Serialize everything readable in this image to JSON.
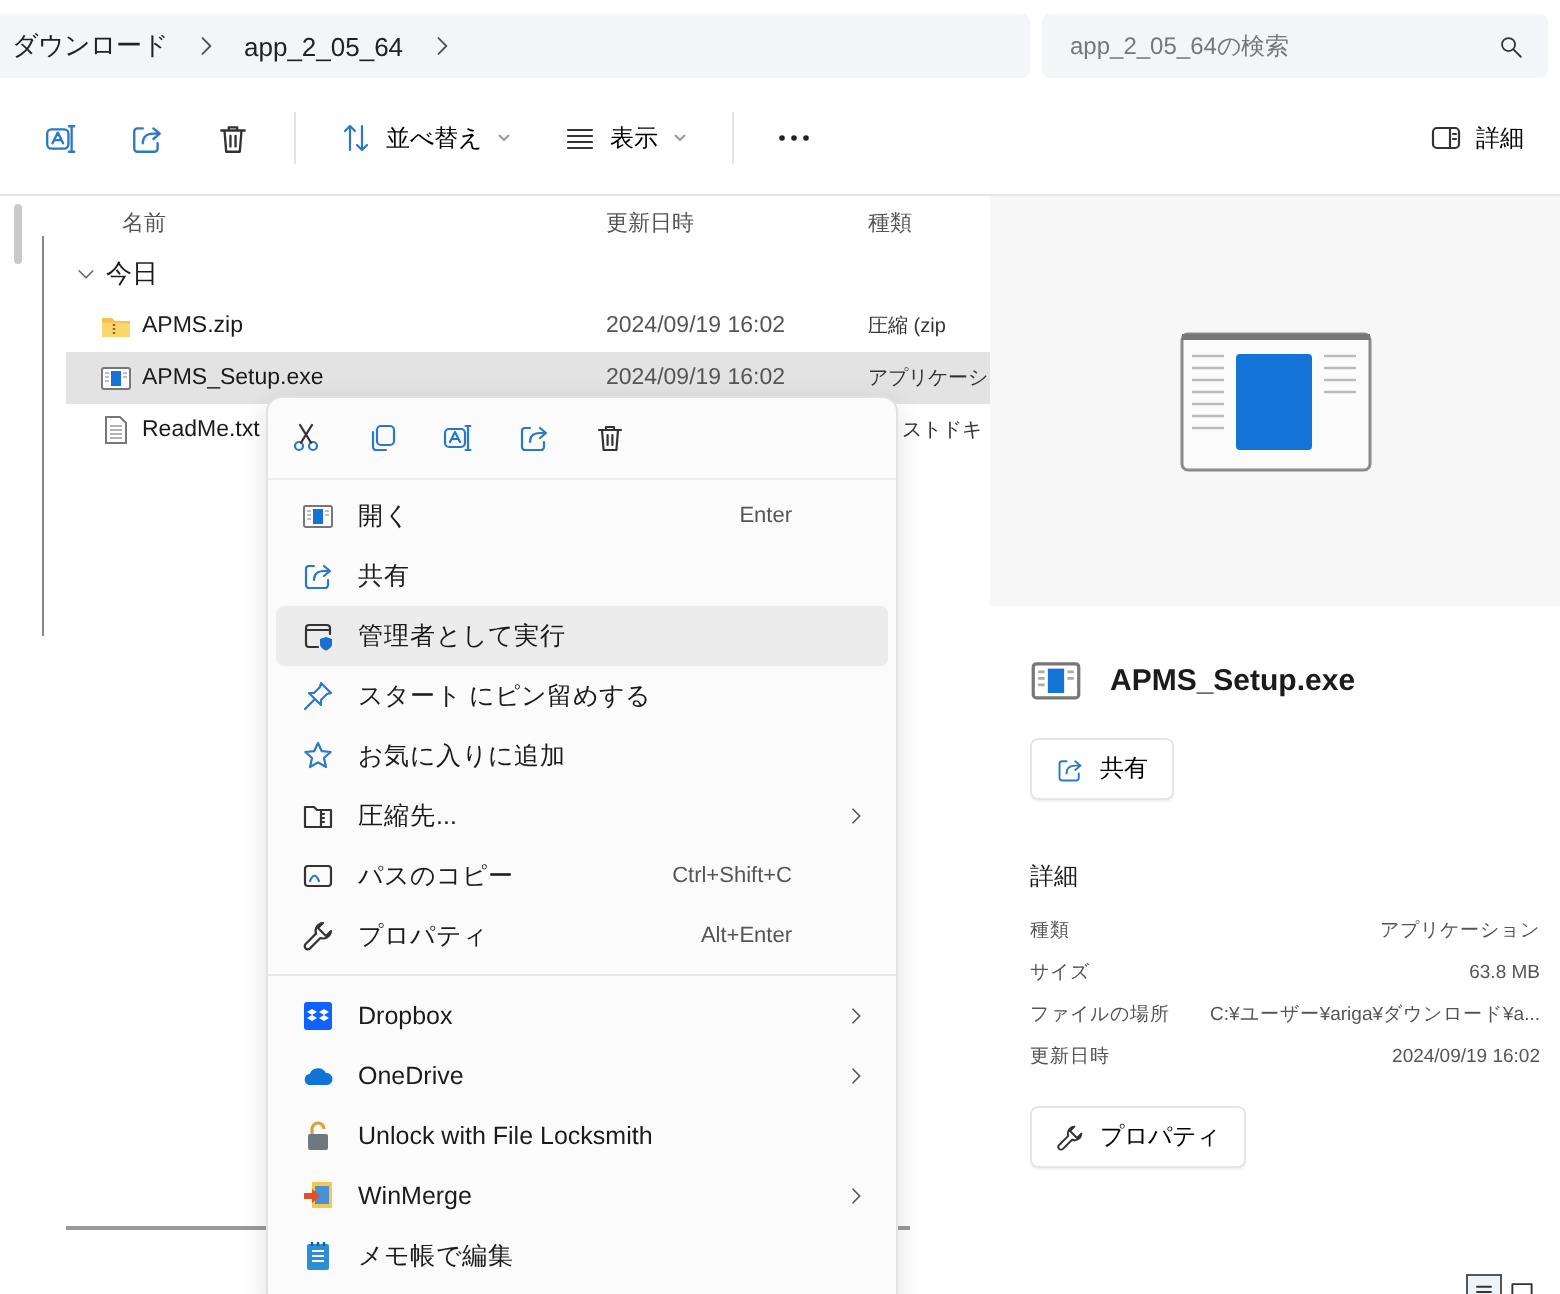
{
  "breadcrumb": [
    "ダウンロード",
    "app_2_05_64"
  ],
  "search": {
    "placeholder": "app_2_05_64の検索"
  },
  "toolbar": {
    "menus": [
      "並べ替え",
      "表示"
    ],
    "details_button": "詳細"
  },
  "columns": [
    "名前",
    "更新日時",
    "種類"
  ],
  "group": {
    "label": "今日",
    "expanded": true
  },
  "files": [
    {
      "name": "APMS.zip",
      "date": "2024/09/19 16:02",
      "type": "圧縮 (zip",
      "selected": false
    },
    {
      "name": "APMS_Setup.exe",
      "date": "2024/09/19 16:02",
      "type": "アプリケーシ",
      "selected": true
    },
    {
      "name": "ReadMe.txt",
      "type": "ストドキ",
      "selected": false
    }
  ],
  "context_menu": {
    "sections": [
      [
        {
          "label": "開く",
          "shortcut": "Enter",
          "submenu": false,
          "selected": false
        },
        {
          "label": "共有",
          "submenu": false,
          "selected": false
        },
        {
          "label": "管理者として実行",
          "submenu": false,
          "selected": true
        },
        {
          "label": "スタート にピン留めする",
          "submenu": false,
          "selected": false
        },
        {
          "label": "お気に入りに追加",
          "submenu": false,
          "selected": false
        },
        {
          "label": "圧縮先...",
          "submenu": true,
          "selected": false
        },
        {
          "label": "パスのコピー",
          "shortcut": "Ctrl+Shift+C",
          "submenu": false,
          "selected": false
        },
        {
          "label": "プロパティ",
          "shortcut": "Alt+Enter",
          "submenu": false,
          "selected": false
        }
      ],
      [
        {
          "label": "Dropbox",
          "submenu": true,
          "selected": false
        },
        {
          "label": "OneDrive",
          "submenu": true,
          "selected": false
        },
        {
          "label": "Unlock with File Locksmith",
          "submenu": false,
          "selected": false
        },
        {
          "label": "WinMerge",
          "submenu": true,
          "selected": false
        },
        {
          "label": "メモ帳で編集",
          "submenu": false,
          "selected": false
        }
      ]
    ]
  },
  "details": {
    "title": "APMS_Setup.exe",
    "share_button": "共有",
    "heading": "詳細",
    "properties": [
      {
        "label": "種類",
        "value": "アプリケーション"
      },
      {
        "label": "サイズ",
        "value": "63.8 MB"
      },
      {
        "label": "ファイルの場所",
        "value": "C:¥ユーザー¥ariga¥ダウンロード¥a..."
      },
      {
        "label": "更新日時",
        "value": "2024/09/19 16:02"
      }
    ],
    "properties_button": "プロパティ"
  },
  "view_toggle": [
    {
      "selected": true
    },
    {
      "selected": false
    }
  ]
}
